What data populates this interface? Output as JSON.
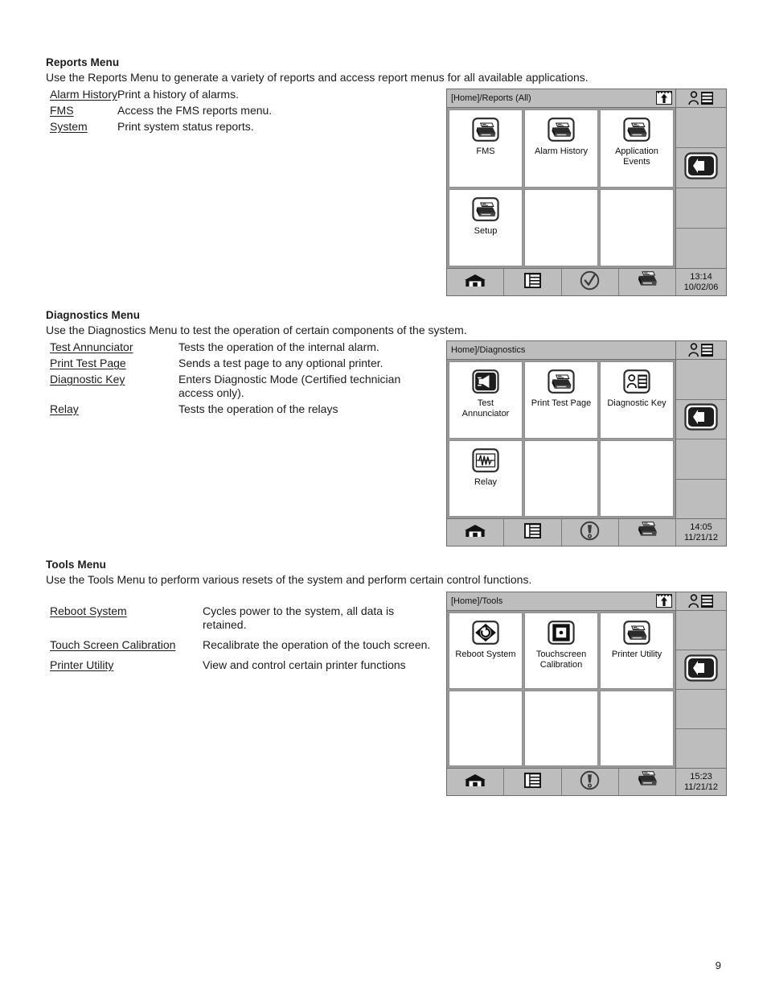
{
  "page": {
    "number": "9"
  },
  "sections": [
    {
      "id": "reports",
      "title": "Reports Menu",
      "intro": "Use the Reports Menu to generate a variety of reports and access report menus for all available applications.",
      "items": [
        {
          "term": "Alarm History",
          "desc": "Print a history of alarms."
        },
        {
          "term": "FMS",
          "desc": "Access the FMS reports menu."
        },
        {
          "term": "System",
          "desc": "Print system status reports."
        }
      ]
    },
    {
      "id": "diagnostics",
      "title": "Diagnostics Menu",
      "intro": "Use the Diagnostics Menu to test the operation of certain components of the system.",
      "items": [
        {
          "term": "Test Annunciator",
          "desc": "Tests the operation of the internal alarm."
        },
        {
          "term": "Print Test Page",
          "desc": "Sends a test page to any optional printer."
        },
        {
          "term": "Diagnostic Key",
          "desc": "Enters Diagnostic Mode (Certified technician access only)."
        },
        {
          "term": "Relay",
          "desc": "Tests the operation of the relays"
        }
      ]
    },
    {
      "id": "tools",
      "title": "Tools Menu",
      "intro": "Use the Tools Menu to perform various resets of the system and perform certain control functions.",
      "items": [
        {
          "term": "Reboot System",
          "desc": "Cycles power to the system, all data is retained."
        },
        {
          "term": "Touch Screen Calibration",
          "desc": "Recalibrate the operation of the touch screen."
        },
        {
          "term": "Printer Utility",
          "desc": "View and control certain printer functions"
        }
      ]
    }
  ],
  "devices": [
    {
      "id": "reports-screen",
      "titlebar": {
        "path": "[Home]/Reports (All)",
        "up_icon": "upload-arrow-icon",
        "user_icon": "user-card-icon"
      },
      "cells": [
        {
          "label": "FMS",
          "icon": "printer-icon"
        },
        {
          "label": "Alarm History",
          "icon": "printer-icon"
        },
        {
          "label": "Application\nEvents",
          "icon": "printer-icon"
        },
        {
          "label": "Setup",
          "icon": "printer-icon"
        },
        {
          "label": "",
          "icon": ""
        },
        {
          "label": "",
          "icon": ""
        }
      ],
      "rail": [
        {
          "icon": ""
        },
        {
          "icon": "back-arrow-icon"
        },
        {
          "icon": ""
        },
        {
          "icon": ""
        }
      ],
      "bottombar": {
        "buttons": [
          {
            "icon": "home-icon"
          },
          {
            "icon": "list-menu-icon"
          },
          {
            "icon": "check-circle-icon"
          },
          {
            "icon": "printer-icon"
          }
        ],
        "time": "13:14",
        "date": "10/02/06"
      }
    },
    {
      "id": "diagnostics-screen",
      "titlebar": {
        "path": "Home]/Diagnostics",
        "up_icon": "",
        "user_icon": "user-card-icon"
      },
      "cells": [
        {
          "label": "Test\nAnnunciator",
          "icon": "speaker-icon"
        },
        {
          "label": "Print Test Page",
          "icon": "printer-icon"
        },
        {
          "label": "Diagnostic Key",
          "icon": "user-card-icon"
        },
        {
          "label": "Relay",
          "icon": "waveform-icon"
        },
        {
          "label": "",
          "icon": ""
        },
        {
          "label": "",
          "icon": ""
        }
      ],
      "rail": [
        {
          "icon": ""
        },
        {
          "icon": "back-arrow-icon"
        },
        {
          "icon": ""
        },
        {
          "icon": ""
        }
      ],
      "bottombar": {
        "buttons": [
          {
            "icon": "home-icon"
          },
          {
            "icon": "list-menu-icon"
          },
          {
            "icon": "alert-circle-icon"
          },
          {
            "icon": "printer-icon"
          }
        ],
        "time": "14:05",
        "date": "11/21/12"
      }
    },
    {
      "id": "tools-screen",
      "titlebar": {
        "path": "[Home]/Tools",
        "up_icon": "upload-arrow-icon",
        "user_icon": "user-card-icon"
      },
      "cells": [
        {
          "label": "Reboot System",
          "icon": "reboot-icon"
        },
        {
          "label": "Touchscreen\nCalibration",
          "icon": "target-icon"
        },
        {
          "label": "Printer Utility",
          "icon": "printer-icon"
        },
        {
          "label": "",
          "icon": ""
        },
        {
          "label": "",
          "icon": ""
        },
        {
          "label": "",
          "icon": ""
        }
      ],
      "rail": [
        {
          "icon": ""
        },
        {
          "icon": "back-arrow-icon"
        },
        {
          "icon": ""
        },
        {
          "icon": ""
        }
      ],
      "bottombar": {
        "buttons": [
          {
            "icon": "home-icon"
          },
          {
            "icon": "list-menu-icon"
          },
          {
            "icon": "alert-circle-icon"
          },
          {
            "icon": "printer-icon"
          }
        ],
        "time": "15:23",
        "date": "11/21/12"
      }
    }
  ],
  "colors": {
    "chrome_gray": "#bdbdbd",
    "grid_gray": "#9a9a9a",
    "ink": "#1b1b1b"
  }
}
